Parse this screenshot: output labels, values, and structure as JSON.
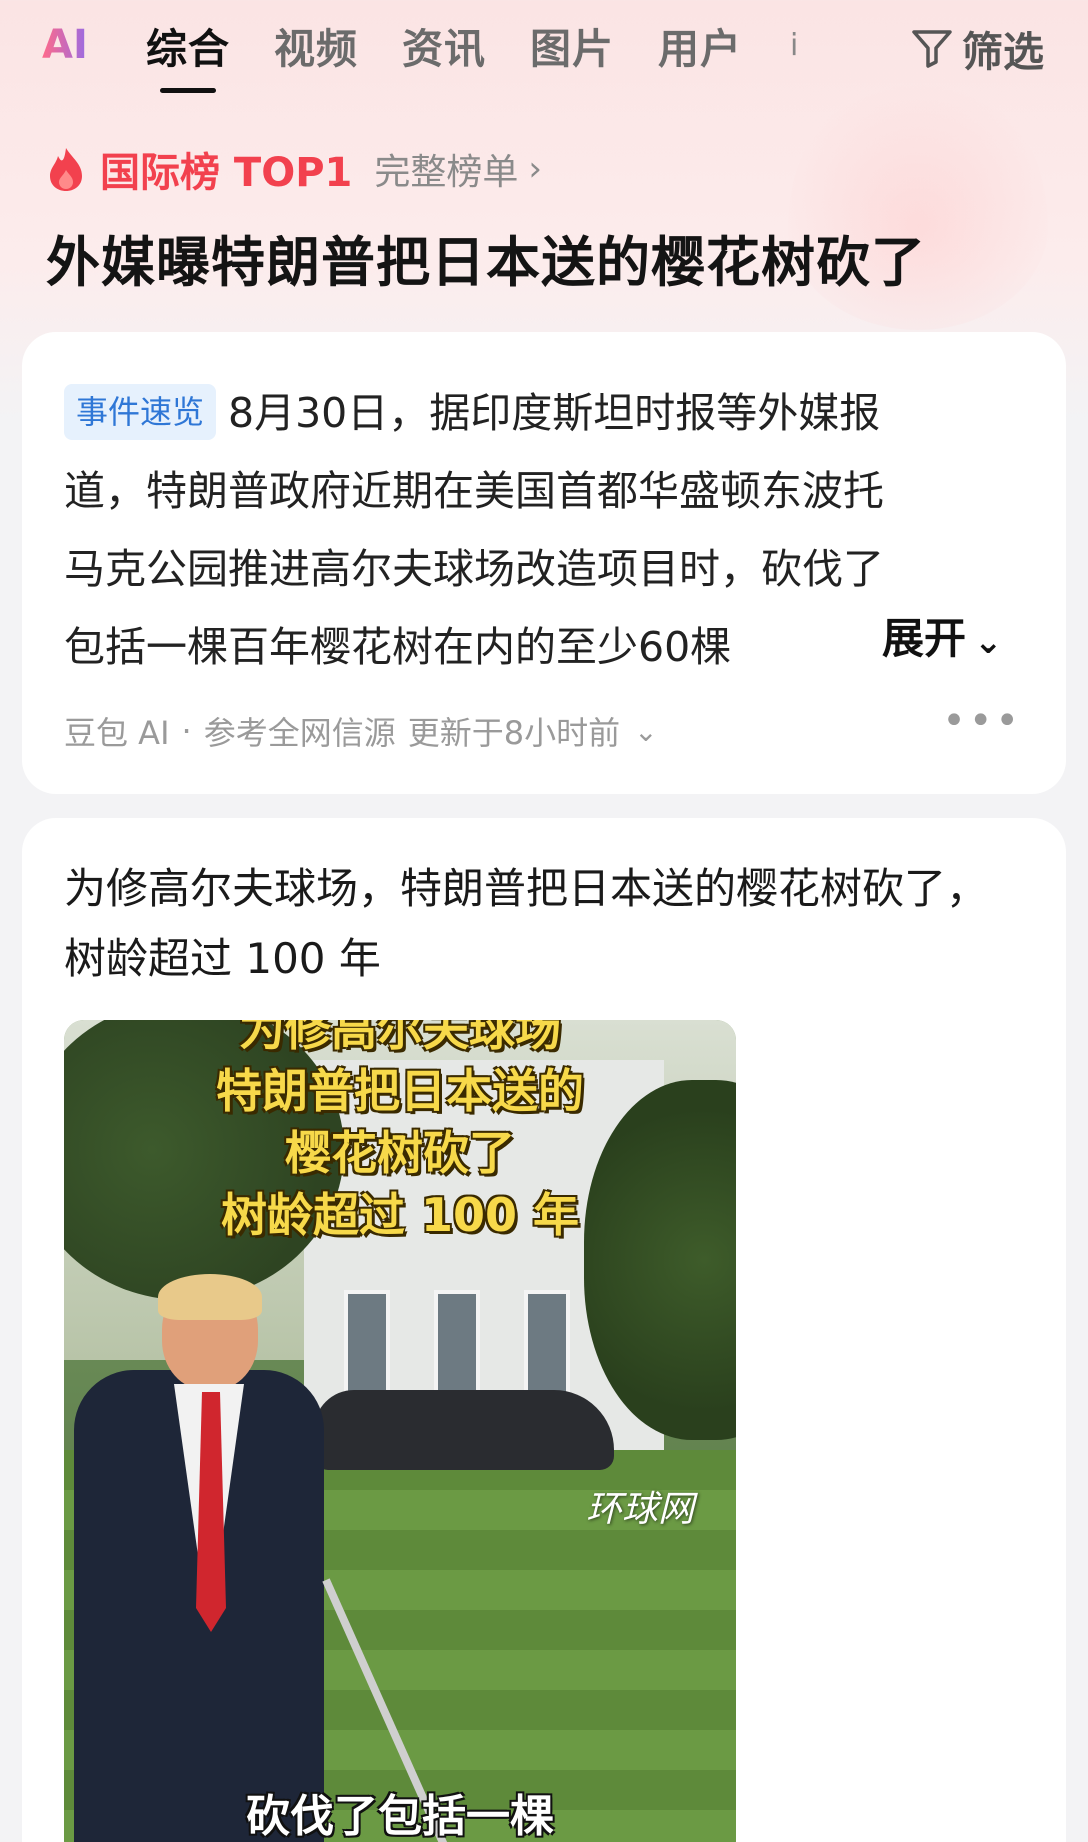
{
  "tabbar": {
    "logo": "AI",
    "tabs": [
      "综合",
      "视频",
      "资讯",
      "图片",
      "用户"
    ],
    "more": "i",
    "filter_label": "筛选"
  },
  "hot": {
    "title": "国际榜 TOP1",
    "link": "完整榜单",
    "headline": "外媒曝特朗普把日本送的樱花树砍了"
  },
  "summary": {
    "badge": "事件速览",
    "lines": [
      "8月30日，据印度斯坦时报等外媒报",
      "道，特朗普政府近期在美国首都华盛顿东波托",
      "马克公园推进高尔夫球场改造项目时，砍伐了",
      "包括一棵百年樱花树在内的至少60棵"
    ],
    "expand_label": "展开",
    "source": "豆包 AI",
    "ref": "参考全网信源",
    "updated": "更新于8小时前"
  },
  "article": {
    "title": "为修高尔夫球场，特朗普把日本送的樱花树砍了，树龄超过 100 年",
    "video": {
      "caption_lines": [
        "为修高尔夫球场",
        "特朗普把日本送的",
        "樱花树砍了",
        "树龄超过 100 年"
      ],
      "watermark": "环球网",
      "subtitle": "砍伐了包括一棵"
    }
  },
  "colors": {
    "accent_red": "#f2414e",
    "badge_blue": "#2f77d6",
    "badge_bg": "#e6f1fd"
  }
}
